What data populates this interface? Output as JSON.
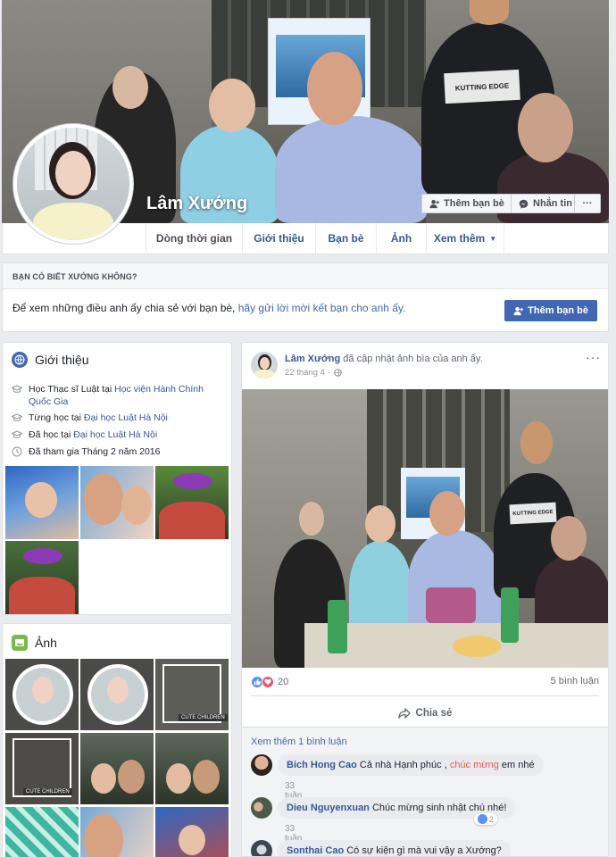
{
  "profile": {
    "name": "Lâm Xướng",
    "add_friend": "Thêm bạn bè",
    "message": "Nhắn tin",
    "more": "···"
  },
  "nav": {
    "tabs": [
      "Dòng thời gian",
      "Giới thiệu",
      "Bạn bè",
      "Ảnh",
      "Xem thêm"
    ]
  },
  "know": {
    "header": "BẠN CÓ BIẾT XƯỚNG KHÔNG?",
    "text_prefix": "Để xem những điều anh ấy chia sẻ với bạn bè, ",
    "text_link": "hãy gửi lời mời kết bạn cho anh ấy.",
    "button": "Thêm bạn bè"
  },
  "intro": {
    "title": "Giới thiệu",
    "rows": [
      {
        "prefix": "Học Thạc sĩ Luật tại ",
        "link": "Học viện Hành Chính Quốc Gia",
        "icon": "graduation-cap-icon"
      },
      {
        "prefix": "Từng học tại ",
        "link": "Đại học Luật Hà Nội",
        "icon": "graduation-cap-icon"
      },
      {
        "prefix": "Đã học tại ",
        "link": "Đại học Luật Hà Nội",
        "icon": "graduation-cap-icon"
      },
      {
        "prefix": "Đã tham gia Tháng 2 năm 2016",
        "link": "",
        "icon": "clock-icon"
      }
    ]
  },
  "photos": {
    "title": "Ảnh",
    "cute_label": "CUTE CHILDREN"
  },
  "post": {
    "author": "Lâm Xướng",
    "action": " đã cập nhật ảnh bìa của anh ấy.",
    "date": "22 tháng 4 ·",
    "more": "···",
    "reaction_count": "20",
    "comment_count": "5 bình luận",
    "share": "Chia sẻ",
    "more_comments": "Xem thêm 1 bình luận",
    "photo_shirt": "KUTTING EDGE",
    "comments": [
      {
        "name": "Bich Hong Cao",
        "text_before": " Cả nhà Hạnh phúc , ",
        "highlight": "chúc mừng",
        "text_after": " em nhé",
        "time": "33 tuần",
        "likes": ""
      },
      {
        "name": "Dieu Nguyenxuan",
        "text_before": " Chúc mừng sinh nhật chú nhé!",
        "highlight": "",
        "text_after": "",
        "time": "33 tuần",
        "likes": "2"
      },
      {
        "name": "Sonthai Cao",
        "text_before": " Có sự kiện gì mà vui vậy a Xướng?",
        "highlight": "",
        "text_after": "",
        "time": "",
        "likes": ""
      }
    ]
  },
  "colors": {
    "brand": "#4267b2",
    "link": "#365899",
    "background": "#e9ebee"
  }
}
